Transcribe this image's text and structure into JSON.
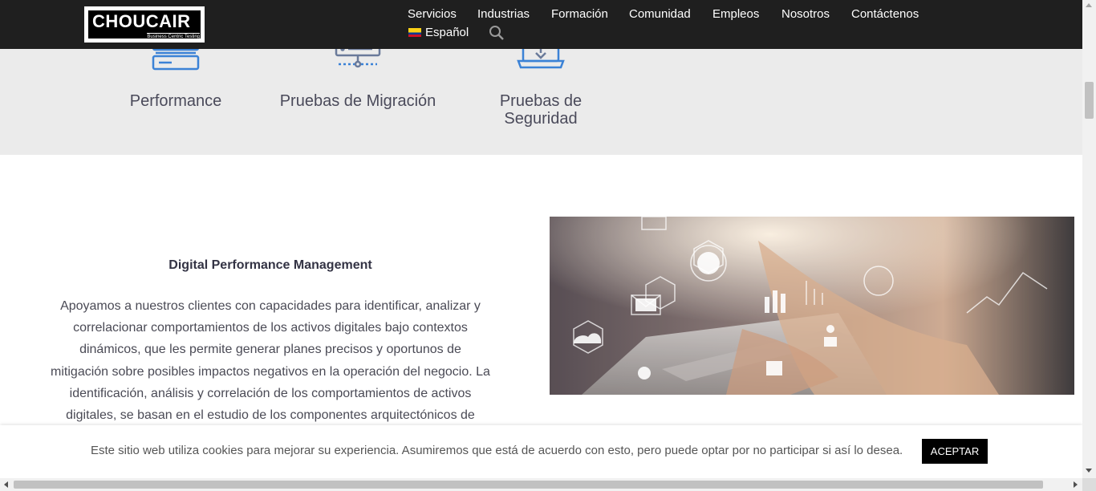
{
  "header": {
    "logo": {
      "name": "CHOUCAIR",
      "tagline": "Business Centric Testing"
    },
    "nav": [
      {
        "label": "Servicios"
      },
      {
        "label": "Industrias"
      },
      {
        "label": "Formación"
      },
      {
        "label": "Comunidad"
      },
      {
        "label": "Empleos"
      },
      {
        "label": "Nosotros"
      },
      {
        "label": "Contáctenos"
      }
    ],
    "language": {
      "label": "Español",
      "flag_icon": "colombia-flag-icon"
    },
    "search_icon": "search-icon"
  },
  "services": [
    {
      "label": "Performance",
      "icon": "server-rack-icon"
    },
    {
      "label": "Pruebas de Migración",
      "icon": "server-network-icon"
    },
    {
      "label": "Pruebas de Seguridad",
      "icon": "laptop-security-icon"
    }
  ],
  "main": {
    "title": "Digital Performance Management",
    "body_lines": [
      "Apoyamos a nuestros clientes con capacidades para identificar, analizar y",
      "correlacionar comportamientos de los activos digitales bajo contextos",
      "dinámicos, que les permite generar planes precisos y oportunos de",
      "mitigación sobre posibles impactos negativos en la operación del negocio. La",
      "identificación, análisis y correlación de los comportamientos de activos",
      "digitales, se basan en el estudio de los componentes arquitectónicos de"
    ]
  },
  "cookie": {
    "text": "Este sitio web utiliza cookies para mejorar su experiencia. Asumiremos que está de acuerdo con esto, pero puede optar por no participar si así lo desea.",
    "accept_label": "ACEPTAR"
  },
  "colors": {
    "header_bg": "#1f1f1f",
    "band_bg": "#ebebeb",
    "icon_blue": "#3b82d6",
    "button_bg": "#000000"
  }
}
